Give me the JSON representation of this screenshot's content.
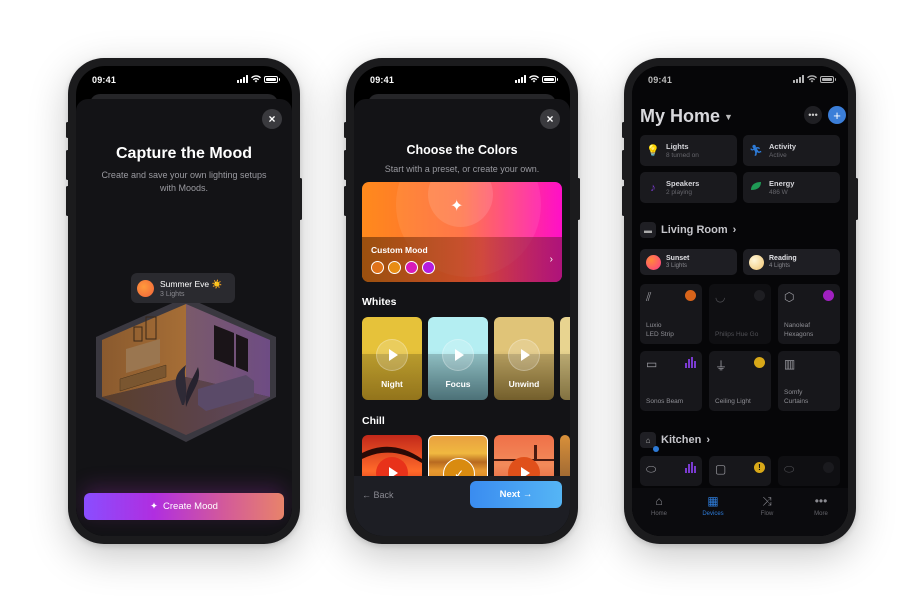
{
  "status_bar": {
    "time": "09:41"
  },
  "screen1": {
    "close_icon": "×",
    "title": "Capture the Mood",
    "subtitle": "Create and save your own lighting setups with Moods.",
    "mood_badge": {
      "name": "Summer Eve ☀️",
      "sub": "3 Lights"
    },
    "cta": {
      "icon": "sparkle-icon",
      "label": "Create Mood"
    }
  },
  "screen2": {
    "close_icon": "×",
    "title": "Choose the Colors",
    "subtitle": "Start with a preset, or create your own.",
    "custom_card": {
      "label": "Custom Mood",
      "swatches": [
        "#e0731a",
        "#e88c14",
        "#d81ab8",
        "#b41ee0"
      ]
    },
    "whites": {
      "label": "Whites",
      "tiles": [
        {
          "label": "Night",
          "top": "#e6c23a",
          "bottom": "#b48e22"
        },
        {
          "label": "Focus",
          "top": "#b4eef2",
          "bottom": "#5d8a92"
        },
        {
          "label": "Unwind",
          "top": "#e0c478",
          "bottom": "#8d7436"
        },
        {
          "label": "",
          "top": "#e8d490",
          "bottom": "#a08c50"
        }
      ]
    },
    "chill": {
      "label": "Chill",
      "tiles": [
        {
          "state": "play"
        },
        {
          "state": "selected"
        },
        {
          "state": "play"
        },
        {
          "state": "none"
        }
      ]
    },
    "back_label": "← Back",
    "next_label": "Next →"
  },
  "screen3": {
    "title": "My Home",
    "summary": [
      {
        "icon": "bulb-icon",
        "name": "Lights",
        "sub": "8 turned on",
        "color": "#c8901a"
      },
      {
        "icon": "activity-icon",
        "name": "Activity",
        "sub": "Active",
        "color": "#2d7ad6"
      },
      {
        "icon": "music-icon",
        "name": "Speakers",
        "sub": "2 playing",
        "color": "#7a3bd0"
      },
      {
        "icon": "leaf-icon",
        "name": "Energy",
        "sub": "486 W",
        "color": "#1f9a55"
      }
    ],
    "living_room": {
      "label": "Living Room",
      "scenes": [
        {
          "name": "Sunset",
          "sub": "3 Lights",
          "color": "#ff5a5a"
        },
        {
          "name": "Reading",
          "sub": "4 Lights",
          "color": "#ffe6a0"
        }
      ],
      "devices": [
        {
          "name": "Luxio\nLED Strip",
          "status": "#d8641a",
          "on": true
        },
        {
          "name": "Philips Hue Go",
          "status": "#222226",
          "on": false
        },
        {
          "name": "Nanoleaf\nHexagons",
          "status": "#a020c0",
          "on": true
        },
        {
          "name": "Sonos Beam",
          "status": "bars",
          "on": true
        },
        {
          "name": "Ceiling Light",
          "status": "#d8a818",
          "on": true
        },
        {
          "name": "Somfy\nCurtains",
          "status": "",
          "on": true
        }
      ]
    },
    "kitchen": {
      "label": "Kitchen"
    },
    "tabs": [
      {
        "label": "Home",
        "icon": "home-icon",
        "active": false
      },
      {
        "label": "Devices",
        "icon": "grid-icon",
        "active": true
      },
      {
        "label": "Flow",
        "icon": "shuffle-icon",
        "active": false
      },
      {
        "label": "More",
        "icon": "more-icon",
        "active": false
      }
    ]
  }
}
